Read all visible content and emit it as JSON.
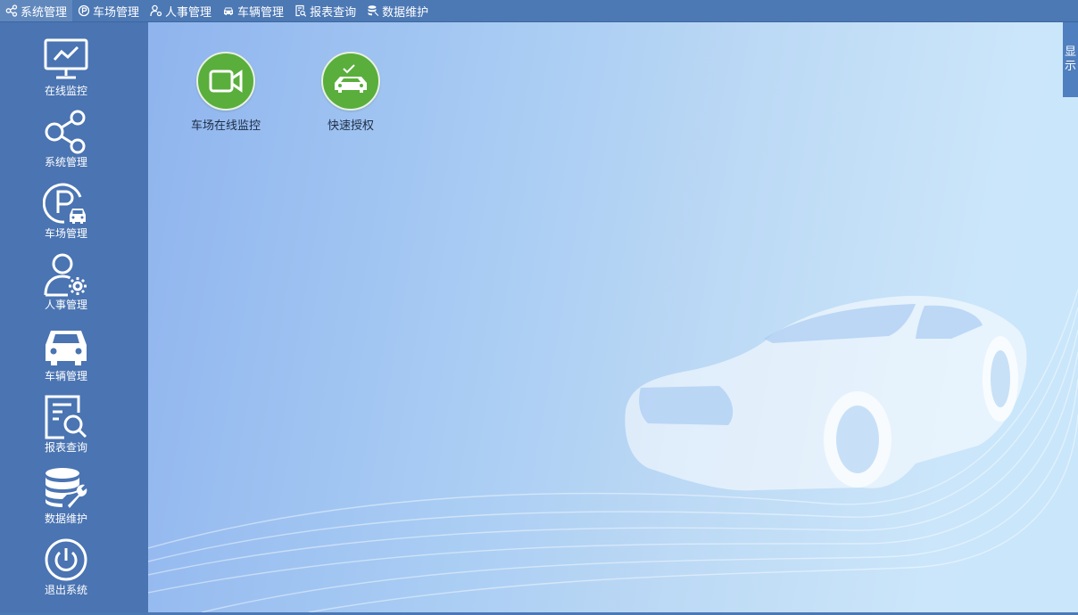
{
  "topbar": {
    "items": [
      {
        "label": "系统管理",
        "icon": "share-nodes-icon"
      },
      {
        "label": "车场管理",
        "icon": "parking-lot-icon"
      },
      {
        "label": "人事管理",
        "icon": "user-gear-icon"
      },
      {
        "label": "车辆管理",
        "icon": "car-icon"
      },
      {
        "label": "报表查询",
        "icon": "report-search-icon"
      },
      {
        "label": "数据维护",
        "icon": "database-wrench-icon"
      }
    ]
  },
  "sidebar": {
    "items": [
      {
        "label": "在线监控",
        "icon": "monitor-chart-icon"
      },
      {
        "label": "系统管理",
        "icon": "share-nodes-icon"
      },
      {
        "label": "车场管理",
        "icon": "parking-car-icon"
      },
      {
        "label": "人事管理",
        "icon": "user-gear-icon"
      },
      {
        "label": "车辆管理",
        "icon": "car-front-icon"
      },
      {
        "label": "报表查询",
        "icon": "report-search-icon"
      },
      {
        "label": "数据维护",
        "icon": "database-wrench-icon"
      },
      {
        "label": "退出系统",
        "icon": "power-icon"
      }
    ]
  },
  "main": {
    "tiles": [
      {
        "label": "车场在线监控",
        "icon": "video-camera-icon"
      },
      {
        "label": "快速授权",
        "icon": "car-check-icon"
      }
    ]
  },
  "side_tab": {
    "line1": "显",
    "line2": "示"
  },
  "colors": {
    "bar": "#4c78b4",
    "sidebar": "#4a74b2",
    "tile_green": "#5aae3c",
    "text_dark": "#1d2d45"
  }
}
